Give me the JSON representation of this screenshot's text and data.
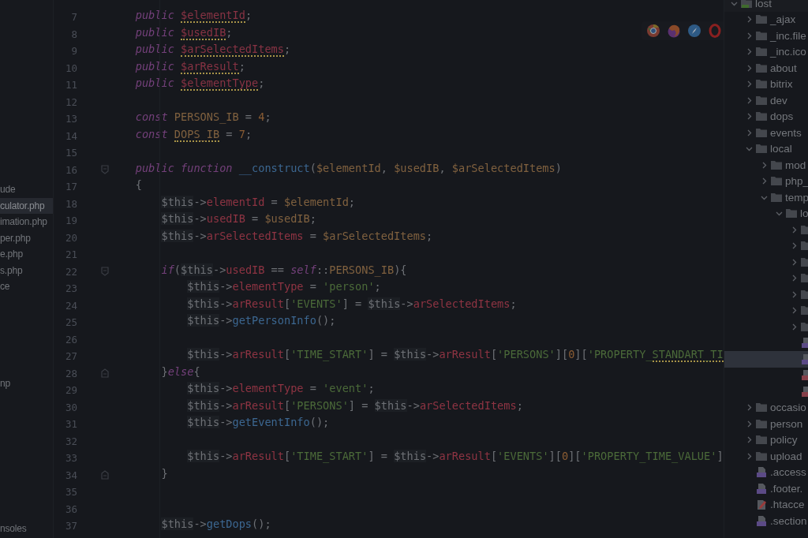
{
  "file_list": {
    "items": [
      {
        "label": "ude",
        "selected": false
      },
      {
        "label": "culator.php",
        "selected": true
      },
      {
        "label": "imation.php",
        "selected": false
      },
      {
        "label": "per.php",
        "selected": false
      },
      {
        "label": "e.php",
        "selected": false
      },
      {
        "label": "s.php",
        "selected": false
      },
      {
        "label": "ce",
        "selected": false
      },
      {
        "label": "np",
        "selected": false
      },
      {
        "label": "nsoles",
        "selected": false
      }
    ]
  },
  "editor": {
    "lines": [
      {
        "number": "7",
        "kind": "code",
        "tokens": [
          {
            "kind": "keyword",
            "text": "public "
          },
          {
            "kind": "field",
            "text": "$elementId",
            "warning": true
          },
          {
            "kind": "plain",
            "text": ";"
          }
        ]
      },
      {
        "number": "8",
        "kind": "code",
        "tokens": [
          {
            "kind": "keyword",
            "text": "public "
          },
          {
            "kind": "field",
            "text": "$usedIB",
            "warning": true
          },
          {
            "kind": "plain",
            "text": ";"
          }
        ]
      },
      {
        "number": "9",
        "kind": "code",
        "tokens": [
          {
            "kind": "keyword",
            "text": "public "
          },
          {
            "kind": "field",
            "text": "$arSelectedItems",
            "warning": true
          },
          {
            "kind": "plain",
            "text": ";"
          }
        ]
      },
      {
        "number": "10",
        "kind": "code",
        "tokens": [
          {
            "kind": "keyword",
            "text": "public "
          },
          {
            "kind": "field",
            "text": "$arResult",
            "warning": true
          },
          {
            "kind": "plain",
            "text": ";"
          }
        ]
      },
      {
        "number": "11",
        "kind": "code",
        "tokens": [
          {
            "kind": "keyword",
            "text": "public "
          },
          {
            "kind": "field",
            "text": "$elementType",
            "warning": true
          },
          {
            "kind": "plain",
            "text": ";"
          }
        ]
      },
      {
        "number": "12",
        "kind": "code"
      },
      {
        "number": "13",
        "kind": "code",
        "tokens": [
          {
            "kind": "keyword",
            "text": "const "
          },
          {
            "kind": "constant",
            "text": "PERSONS_IB"
          },
          {
            "kind": "plain",
            "text": " = "
          },
          {
            "kind": "number",
            "text": "4"
          },
          {
            "kind": "plain",
            "text": ";"
          }
        ]
      },
      {
        "number": "14",
        "kind": "code",
        "tokens": [
          {
            "kind": "keyword",
            "text": "const "
          },
          {
            "kind": "constant",
            "text": "DOPS_IB",
            "warning": true
          },
          {
            "kind": "plain",
            "text": " = "
          },
          {
            "kind": "number",
            "text": "7"
          },
          {
            "kind": "plain",
            "text": ";"
          }
        ]
      },
      {
        "number": "15",
        "kind": "code"
      },
      {
        "number": "16",
        "kind": "block_start",
        "tokens": [
          {
            "kind": "keyword",
            "text": "public function "
          },
          {
            "kind": "method",
            "text": "__construct"
          },
          {
            "kind": "plain",
            "text": "("
          },
          {
            "kind": "variable",
            "text": "$elementId"
          },
          {
            "kind": "plain",
            "text": ", "
          },
          {
            "kind": "variable",
            "text": "$usedIB"
          },
          {
            "kind": "plain",
            "text": ", "
          },
          {
            "kind": "variable",
            "text": "$arSelectedItems"
          },
          {
            "kind": "plain",
            "text": ")"
          }
        ]
      },
      {
        "number": "17",
        "kind": "code",
        "tokens": [
          {
            "kind": "plain",
            "text": "{"
          }
        ],
        "children": [
          {
            "number": "18",
            "kind": "code",
            "tokens": [
              {
                "kind": "this",
                "text": "$this"
              },
              {
                "kind": "plain",
                "text": "->"
              },
              {
                "kind": "property",
                "text": "elementId"
              },
              {
                "kind": "plain",
                "text": " = "
              },
              {
                "kind": "variable",
                "text": "$elementId"
              },
              {
                "kind": "plain",
                "text": ";"
              }
            ]
          },
          {
            "number": "19",
            "kind": "code",
            "tokens": [
              {
                "kind": "this",
                "text": "$this"
              },
              {
                "kind": "plain",
                "text": "->"
              },
              {
                "kind": "property",
                "text": "usedIB"
              },
              {
                "kind": "plain",
                "text": " = "
              },
              {
                "kind": "variable",
                "text": "$usedIB"
              },
              {
                "kind": "plain",
                "text": ";"
              }
            ]
          },
          {
            "number": "20",
            "kind": "code",
            "tokens": [
              {
                "kind": "this",
                "text": "$this"
              },
              {
                "kind": "plain",
                "text": "->"
              },
              {
                "kind": "property",
                "text": "arSelectedItems"
              },
              {
                "kind": "plain",
                "text": " = "
              },
              {
                "kind": "variable",
                "text": "$arSelectedItems"
              },
              {
                "kind": "plain",
                "text": ";"
              }
            ]
          },
          {
            "number": "21",
            "kind": "code"
          },
          {
            "number": "22",
            "kind": "block_start",
            "tokens": [
              {
                "kind": "keyword",
                "text": "if"
              },
              {
                "kind": "plain",
                "text": "("
              },
              {
                "kind": "this",
                "text": "$this"
              },
              {
                "kind": "plain",
                "text": "->"
              },
              {
                "kind": "property",
                "text": "usedIB"
              },
              {
                "kind": "plain",
                "text": " == "
              },
              {
                "kind": "keyword",
                "text": "self"
              },
              {
                "kind": "plain",
                "text": "::"
              },
              {
                "kind": "constant",
                "text": "PERSONS_IB"
              },
              {
                "kind": "plain",
                "text": "){"
              }
            ],
            "children": [
              {
                "number": "23",
                "kind": "code",
                "tokens": [
                  {
                    "kind": "this",
                    "text": "$this"
                  },
                  {
                    "kind": "plain",
                    "text": "->"
                  },
                  {
                    "kind": "property",
                    "text": "elementType"
                  },
                  {
                    "kind": "plain",
                    "text": " = "
                  },
                  {
                    "kind": "string",
                    "text": "'person'"
                  },
                  {
                    "kind": "plain",
                    "text": ";"
                  }
                ]
              },
              {
                "number": "24",
                "kind": "code",
                "tokens": [
                  {
                    "kind": "this",
                    "text": "$this"
                  },
                  {
                    "kind": "plain",
                    "text": "->"
                  },
                  {
                    "kind": "property",
                    "text": "arResult"
                  },
                  {
                    "kind": "plain",
                    "text": "["
                  },
                  {
                    "kind": "string",
                    "text": "'EVENTS'"
                  },
                  {
                    "kind": "plain",
                    "text": "] = "
                  },
                  {
                    "kind": "this",
                    "text": "$this"
                  },
                  {
                    "kind": "plain",
                    "text": "->"
                  },
                  {
                    "kind": "property",
                    "text": "arSelectedItems"
                  },
                  {
                    "kind": "plain",
                    "text": ";"
                  }
                ]
              },
              {
                "number": "25",
                "kind": "code",
                "tokens": [
                  {
                    "kind": "this",
                    "text": "$this"
                  },
                  {
                    "kind": "plain",
                    "text": "->"
                  },
                  {
                    "kind": "method",
                    "text": "getPersonInfo"
                  },
                  {
                    "kind": "plain",
                    "text": "();"
                  }
                ]
              },
              {
                "number": "26",
                "kind": "code"
              },
              {
                "number": "27",
                "kind": "code",
                "tokens": [
                  {
                    "kind": "this",
                    "text": "$this"
                  },
                  {
                    "kind": "plain",
                    "text": "->"
                  },
                  {
                    "kind": "property",
                    "text": "arResult"
                  },
                  {
                    "kind": "plain",
                    "text": "["
                  },
                  {
                    "kind": "string",
                    "text": "'TIME_START'"
                  },
                  {
                    "kind": "plain",
                    "text": "] = "
                  },
                  {
                    "kind": "this",
                    "text": "$this"
                  },
                  {
                    "kind": "plain",
                    "text": "->"
                  },
                  {
                    "kind": "property",
                    "text": "arResult"
                  },
                  {
                    "kind": "plain",
                    "text": "["
                  },
                  {
                    "kind": "string",
                    "text": "'PERSONS'"
                  },
                  {
                    "kind": "plain",
                    "text": "]["
                  },
                  {
                    "kind": "number",
                    "text": "0"
                  },
                  {
                    "kind": "plain",
                    "text": "]["
                  },
                  {
                    "kind": "string",
                    "text": "'PROPERTY_"
                  },
                  {
                    "kind": "string",
                    "text": "STANDART_TI",
                    "warning": true
                  }
                ]
              }
            ]
          },
          {
            "number": "28",
            "kind": "block_end",
            "tokens": [
              {
                "kind": "plain",
                "text": "}"
              },
              {
                "kind": "keyword",
                "text": "else"
              },
              {
                "kind": "plain",
                "text": "{"
              }
            ],
            "children": [
              {
                "number": "29",
                "kind": "code",
                "tokens": [
                  {
                    "kind": "this",
                    "text": "$this"
                  },
                  {
                    "kind": "plain",
                    "text": "->"
                  },
                  {
                    "kind": "property",
                    "text": "elementType"
                  },
                  {
                    "kind": "plain",
                    "text": " = "
                  },
                  {
                    "kind": "string",
                    "text": "'event'"
                  },
                  {
                    "kind": "plain",
                    "text": ";"
                  }
                ]
              },
              {
                "number": "30",
                "kind": "code",
                "tokens": [
                  {
                    "kind": "this",
                    "text": "$this"
                  },
                  {
                    "kind": "plain",
                    "text": "->"
                  },
                  {
                    "kind": "property",
                    "text": "arResult"
                  },
                  {
                    "kind": "plain",
                    "text": "["
                  },
                  {
                    "kind": "string",
                    "text": "'PERSONS'"
                  },
                  {
                    "kind": "plain",
                    "text": "] = "
                  },
                  {
                    "kind": "this",
                    "text": "$this"
                  },
                  {
                    "kind": "plain",
                    "text": "->"
                  },
                  {
                    "kind": "property",
                    "text": "arSelectedItems"
                  },
                  {
                    "kind": "plain",
                    "text": ";"
                  }
                ]
              },
              {
                "number": "31",
                "kind": "code",
                "tokens": [
                  {
                    "kind": "this",
                    "text": "$this"
                  },
                  {
                    "kind": "plain",
                    "text": "->"
                  },
                  {
                    "kind": "method",
                    "text": "getEventInfo"
                  },
                  {
                    "kind": "plain",
                    "text": "();"
                  }
                ]
              },
              {
                "number": "32",
                "kind": "code"
              },
              {
                "number": "33",
                "kind": "code",
                "tokens": [
                  {
                    "kind": "this",
                    "text": "$this"
                  },
                  {
                    "kind": "plain",
                    "text": "->"
                  },
                  {
                    "kind": "property",
                    "text": "arResult"
                  },
                  {
                    "kind": "plain",
                    "text": "["
                  },
                  {
                    "kind": "string",
                    "text": "'TIME_START'"
                  },
                  {
                    "kind": "plain",
                    "text": "] = "
                  },
                  {
                    "kind": "this",
                    "text": "$this"
                  },
                  {
                    "kind": "plain",
                    "text": "->"
                  },
                  {
                    "kind": "property",
                    "text": "arResult"
                  },
                  {
                    "kind": "plain",
                    "text": "["
                  },
                  {
                    "kind": "string",
                    "text": "'EVENTS'"
                  },
                  {
                    "kind": "plain",
                    "text": "]["
                  },
                  {
                    "kind": "number",
                    "text": "0"
                  },
                  {
                    "kind": "plain",
                    "text": "]["
                  },
                  {
                    "kind": "string",
                    "text": "'PROPERTY_TIME_VALUE'"
                  },
                  {
                    "kind": "plain",
                    "text": "]"
                  }
                ]
              }
            ]
          },
          {
            "number": "34",
            "kind": "block_end",
            "tokens": [
              {
                "kind": "plain",
                "text": "}"
              }
            ]
          },
          {
            "number": "35",
            "kind": "code"
          },
          {
            "number": "36",
            "kind": "code"
          },
          {
            "number": "37",
            "kind": "code",
            "tokens": [
              {
                "kind": "this",
                "text": "$this"
              },
              {
                "kind": "plain",
                "text": "->"
              },
              {
                "kind": "method",
                "text": "getDops"
              },
              {
                "kind": "plain",
                "text": "();"
              }
            ]
          }
        ]
      }
    ]
  },
  "project_tree": {
    "root": {
      "label": "lost",
      "kind": "module",
      "expanded": true,
      "selected": false,
      "children": [
        {
          "label": "_ajax",
          "kind": "folder",
          "expanded": false,
          "selected": false
        },
        {
          "label": "_inc.file",
          "kind": "folder",
          "expanded": false,
          "selected": false
        },
        {
          "label": "_inc.ico",
          "kind": "folder",
          "expanded": false,
          "selected": false
        },
        {
          "label": "about",
          "kind": "folder",
          "expanded": false,
          "selected": false
        },
        {
          "label": "bitrix",
          "kind": "folder",
          "expanded": false,
          "selected": false
        },
        {
          "label": "dev",
          "kind": "folder",
          "expanded": false,
          "selected": false
        },
        {
          "label": "dops",
          "kind": "folder",
          "expanded": false,
          "selected": false
        },
        {
          "label": "events",
          "kind": "folder",
          "expanded": false,
          "selected": false
        },
        {
          "label": "local",
          "kind": "folder",
          "expanded": true,
          "selected": false,
          "children": [
            {
              "label": "mod",
              "kind": "folder",
              "expanded": false,
              "selected": false
            },
            {
              "label": "php_",
              "kind": "folder",
              "expanded": false,
              "selected": false
            },
            {
              "label": "temp",
              "kind": "folder",
              "expanded": true,
              "selected": false,
              "children": [
                {
                  "label": "lo",
                  "kind": "folder",
                  "expanded": true,
                  "selected": false,
                  "children": [
                    {
                      "kind": "folder",
                      "expanded": false,
                      "selected": false
                    },
                    {
                      "kind": "folder",
                      "expanded": false,
                      "selected": false
                    },
                    {
                      "kind": "folder",
                      "expanded": false,
                      "selected": false
                    },
                    {
                      "kind": "folder",
                      "expanded": false,
                      "selected": false
                    },
                    {
                      "kind": "folder",
                      "expanded": false,
                      "selected": false
                    },
                    {
                      "kind": "folder",
                      "expanded": false,
                      "selected": false
                    },
                    {
                      "kind": "folder",
                      "expanded": false,
                      "selected": false
                    },
                    {
                      "kind": "php",
                      "selected": false
                    },
                    {
                      "kind": "php",
                      "selected": true
                    },
                    {
                      "kind": "image",
                      "selected": false
                    },
                    {
                      "kind": "image",
                      "selected": false
                    }
                  ]
                }
              ]
            }
          ]
        },
        {
          "label": "occasio",
          "kind": "folder",
          "expanded": false,
          "selected": false
        },
        {
          "label": "person",
          "kind": "folder",
          "expanded": false,
          "selected": false
        },
        {
          "label": "policy",
          "kind": "folder",
          "expanded": false,
          "selected": false
        },
        {
          "label": "upload",
          "kind": "folder",
          "expanded": false,
          "selected": false
        },
        {
          "label": ".access",
          "kind": "php",
          "selected": false
        },
        {
          "label": ".footer.",
          "kind": "php",
          "selected": false
        },
        {
          "label": ".htacce",
          "kind": "config",
          "selected": false
        },
        {
          "label": ".section",
          "kind": "php",
          "selected": false
        }
      ]
    }
  }
}
